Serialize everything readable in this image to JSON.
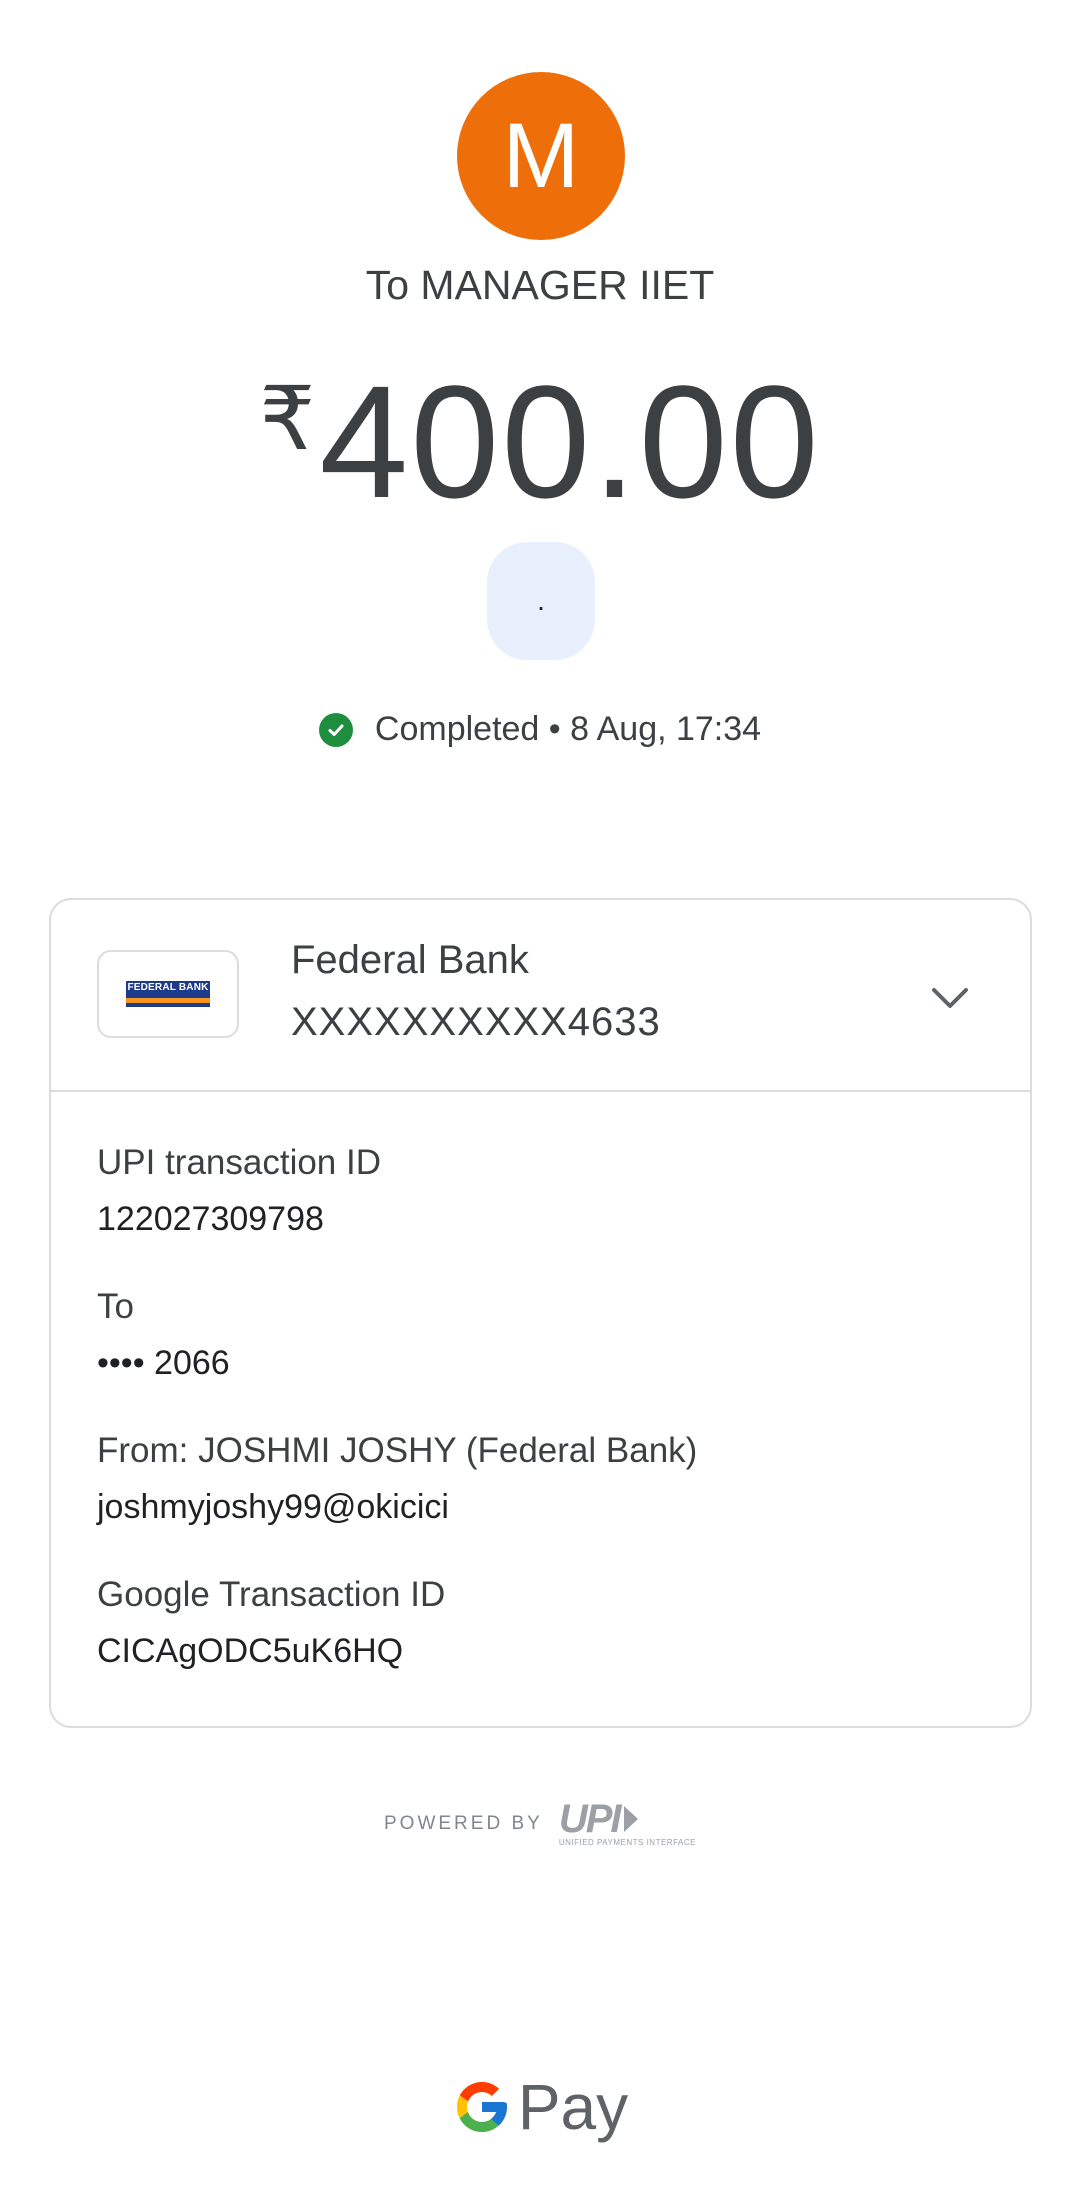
{
  "avatar": {
    "letter": "M",
    "color": "#ee6e0a"
  },
  "recipient": {
    "label": "To MANAGER IIET"
  },
  "amount": {
    "currency": "₹",
    "value": "400.00"
  },
  "note": {
    "text": "."
  },
  "status": {
    "icon": "check-circle-icon",
    "text": "Completed • 8 Aug, 17:34",
    "color": "#1e8e3e"
  },
  "bank": {
    "logo_text": "FEDERAL BANK",
    "name": "Federal Bank",
    "account": "XXXXXXXXXX4633",
    "expand_icon": "chevron-down-icon"
  },
  "details": [
    {
      "label": "UPI transaction ID",
      "value": "122027309798"
    },
    {
      "label": "To",
      "value": "•••• 2066"
    },
    {
      "label": "From: JOSHMI JOSHY (Federal Bank)",
      "value": "joshmyjoshy99@okicici"
    },
    {
      "label": "Google Transaction ID",
      "value": "CICAgODC5uK6HQ"
    }
  ],
  "footer": {
    "powered_by": "POWERED BY",
    "upi_logo": "UPI",
    "upi_sub": "UNIFIED PAYMENTS INTERFACE",
    "gpay_label": "Pay"
  }
}
